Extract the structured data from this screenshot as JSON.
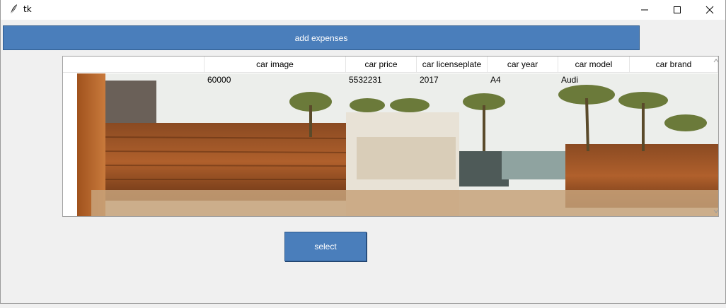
{
  "window": {
    "title": "tk"
  },
  "buttons": {
    "add_expenses": "add expenses",
    "select": "select"
  },
  "table": {
    "columns": [
      "car image",
      "car price",
      "car licenseplate",
      "car year",
      "car model",
      "car brand"
    ],
    "rows": [
      {
        "cells": [
          "60000",
          "5532231",
          "2017",
          "A4",
          "Audi"
        ]
      }
    ]
  },
  "colors": {
    "button": "#4a7ebb",
    "button_text": "#ffffff",
    "background": "#f0f0f0"
  },
  "icons": {
    "app": "feather-icon",
    "minimize": "minimize-icon",
    "maximize": "maximize-icon",
    "close": "close-icon"
  }
}
